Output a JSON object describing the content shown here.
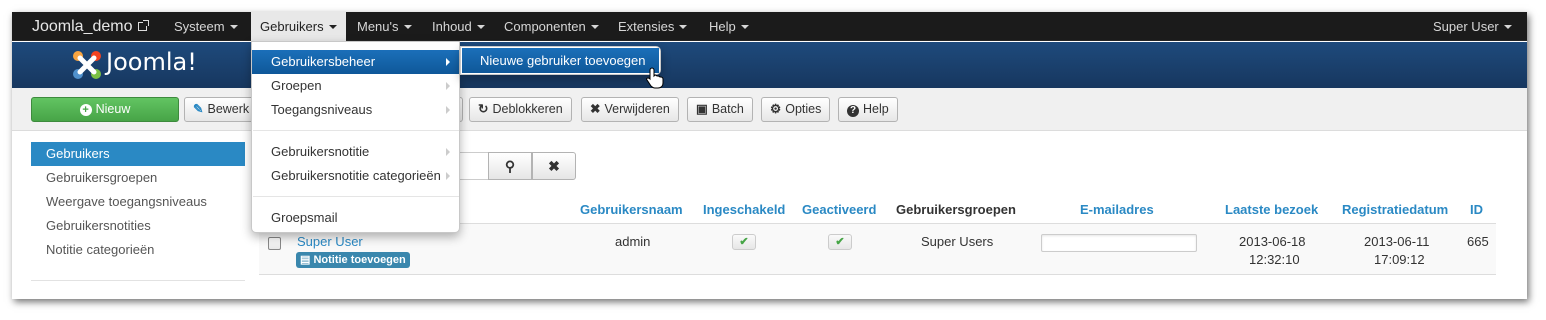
{
  "navbar": {
    "brand": "Joomla_demo",
    "items": [
      "Systeem",
      "Gebruikers",
      "Menu's",
      "Inhoud",
      "Componenten",
      "Extensies",
      "Help"
    ],
    "user": "Super User"
  },
  "header": {
    "logo_text": "Joomla!"
  },
  "toolbar": {
    "new": "Nieuw",
    "edit": "Bewerk",
    "unblock": "Deblokkeren",
    "delete": "Verwijderen",
    "batch": "Batch",
    "options": "Opties",
    "help": "Help"
  },
  "sidebar": {
    "items": [
      "Gebruikers",
      "Gebruikersgroepen",
      "Weergave toegangsniveaus",
      "Gebruikersnotities",
      "Notitie categorieën"
    ]
  },
  "table": {
    "headers": {
      "username": "Gebruikersnaam",
      "enabled": "Ingeschakeld",
      "activated": "Geactiveerd",
      "groups": "Gebruikersgroepen",
      "email": "E-mailadres",
      "last_visit": "Laatste bezoek",
      "registered": "Registratiedatum",
      "id": "ID"
    },
    "row": {
      "name": "Super User",
      "note_badge": "Notitie toevoegen",
      "username": "admin",
      "groups": "Super Users",
      "last_visit_date": "2013-06-18",
      "last_visit_time": "12:32:10",
      "registered_date": "2013-06-11",
      "registered_time": "17:09:12",
      "id": "665"
    }
  },
  "dropdown": {
    "items": [
      "Gebruikersbeheer",
      "Groepen",
      "Toegangsniveaus",
      "Gebruikersnotitie",
      "Gebruikersnotitie categorieën",
      "Groepsmail"
    ],
    "submenu_item": "Nieuwe gebruiker toevoegen"
  },
  "colors": {
    "accent": "#2a89c4",
    "navbar": "#1b1b1b",
    "header": "#1e4a7c",
    "success": "#47a447"
  }
}
